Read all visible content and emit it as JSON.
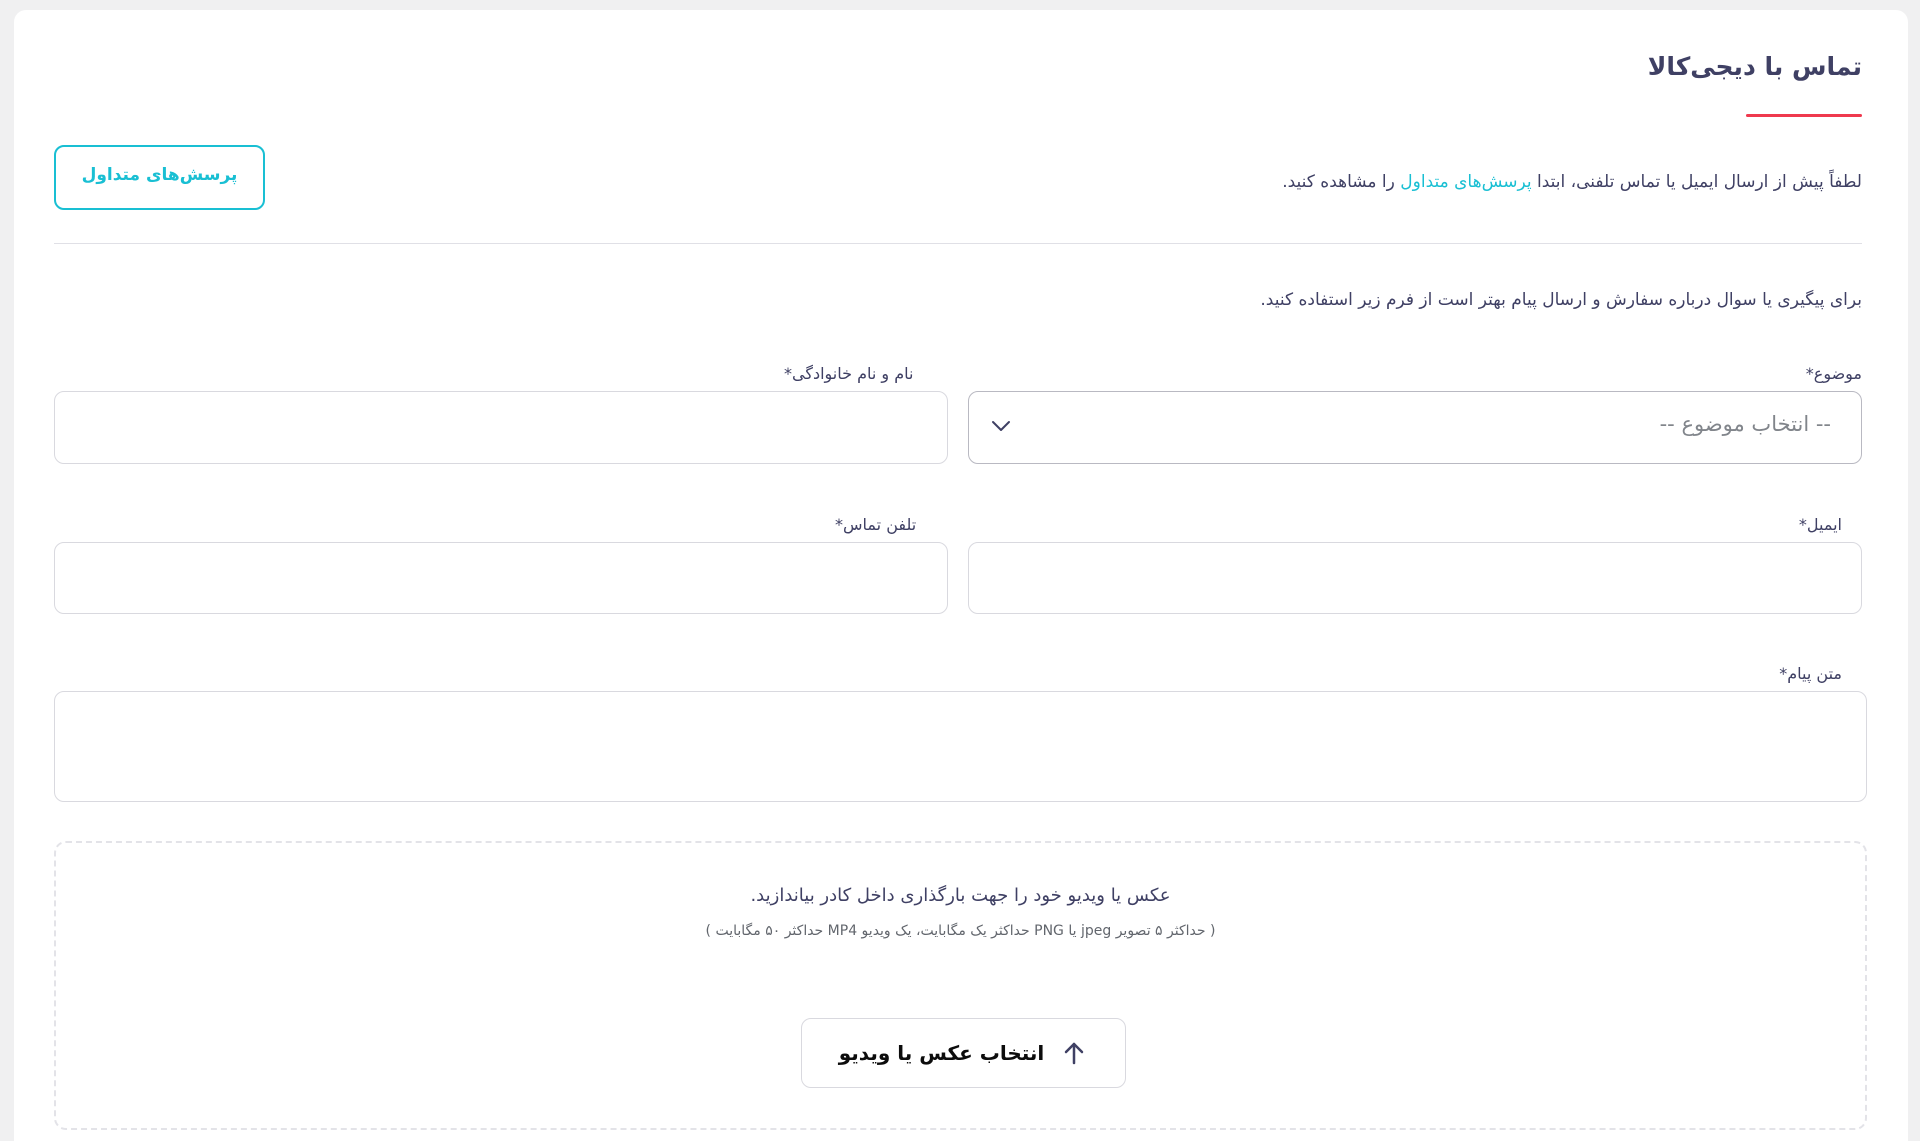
{
  "header": {
    "title": "تماس با دیجی‌کالا",
    "accent_color": "#ef394e"
  },
  "notice": {
    "prefix": "لطفاً پیش از ارسال ایمیل یا تماس تلفنی، ابتدا ",
    "link_text": "پرسش‌های متداول",
    "suffix": " را مشاهده کنید.",
    "link_color": "#19bfd3"
  },
  "faq_button": {
    "label": "پرسش‌های متداول"
  },
  "intro_text": "برای پیگیری یا سوال درباره سفارش و ارسال پیام بهتر است از فرم زیر استفاده کنید.",
  "form": {
    "subject": {
      "label": "موضوع*",
      "selected_value": "-- انتخاب موضوع --",
      "icon": "chevron-down-icon"
    },
    "full_name": {
      "label": "نام و نام خانوادگی*",
      "value": ""
    },
    "email": {
      "label": "ایمیل*",
      "value": ""
    },
    "phone": {
      "label": "تلفن تماس*",
      "value": ""
    },
    "message": {
      "label": "متن پیام*",
      "value": ""
    }
  },
  "upload": {
    "title": "عکس یا ویدیو خود را جهت بارگذاری داخل کادر بیاندازید.",
    "hint": "( حداکثر ۵ تصویر jpeg یا PNG حداکثر یک مگابایت، یک ویدیو MP4 حداکثر ۵۰ مگابایت )",
    "button_label": "انتخاب عکس یا ویدیو",
    "icon": "arrow-up-icon"
  }
}
